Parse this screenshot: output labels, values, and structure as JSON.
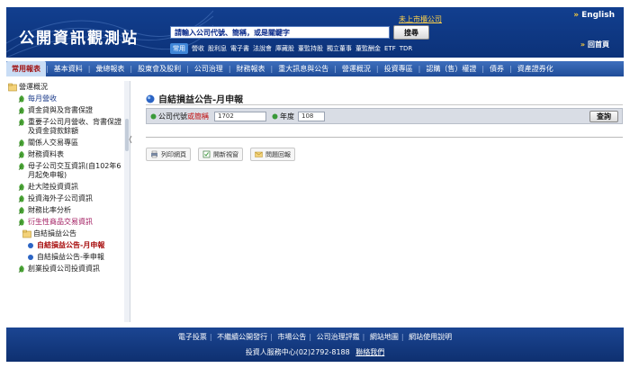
{
  "header": {
    "logo": "公開資訊觀測站",
    "search_placeholder": "請輸入公司代號、簡稱，或是關鍵字",
    "search_button": "搜尋",
    "upcoming": "未上市櫃公司",
    "english": "English",
    "home": "回首頁",
    "quick_tag": "常用",
    "quick_links": [
      "營收",
      "股利息",
      "電子書",
      "法說會",
      "庫藏股",
      "董監持股",
      "獨立董事",
      "董監酬金",
      "ETF",
      "TDR"
    ]
  },
  "nav": {
    "items": [
      "常用報表",
      "基本資料",
      "彙總報表",
      "股東會及股利",
      "公司治理",
      "財務報表",
      "重大訊息與公告",
      "營運概況",
      "投資專區",
      "認購（售）權證",
      "債券",
      "資產證券化"
    ],
    "active_index": 0
  },
  "sidebar": {
    "root": "營運概況",
    "items": [
      {
        "label": "每月營收",
        "level": 1,
        "style": "blue"
      },
      {
        "label": "資金貸與及背書保證",
        "level": 1,
        "style": ""
      },
      {
        "label": "重要子公司月營收、背書保證及資金貸款餘額",
        "level": 1,
        "style": ""
      },
      {
        "label": "關係人交易專區",
        "level": 1,
        "style": ""
      },
      {
        "label": "財務資料表",
        "level": 1,
        "style": ""
      },
      {
        "label": "母子公司交互資訊(自102年6月起免申報)",
        "level": 1,
        "style": ""
      },
      {
        "label": "赴大陸投資資訊",
        "level": 1,
        "style": ""
      },
      {
        "label": "投資海外子公司資訊",
        "level": 1,
        "style": ""
      },
      {
        "label": "財務比率分析",
        "level": 1,
        "style": ""
      },
      {
        "label": "衍生性商品交易資訊",
        "level": 1,
        "style": "pink"
      },
      {
        "label": "自結損益公告",
        "level": 2,
        "style": "",
        "folder": true
      },
      {
        "label": "自結損益公告-月申報",
        "level": 3,
        "style": "cur"
      },
      {
        "label": "自結損益公告-季申報",
        "level": 3,
        "style": ""
      },
      {
        "label": "創業投資公司投資資訊",
        "level": 1,
        "style": ""
      }
    ]
  },
  "main": {
    "title": "自結損益公告-月申報",
    "company_label": "公司代號",
    "company_label_alt": "或簡稱",
    "company_value": "1702",
    "year_label": "年度",
    "year_value": "108",
    "query_button": "查詢",
    "actions": [
      "列印網頁",
      "開新視窗",
      "問題回報"
    ]
  },
  "footer": {
    "links": [
      "電子投票",
      "不繼續公開發行",
      "市場公告",
      "公司治理評鑑",
      "網站地圖",
      "網站使用說明"
    ],
    "hotline": "投資人服務中心(02)2792-8188",
    "contact": "聯絡我們"
  }
}
